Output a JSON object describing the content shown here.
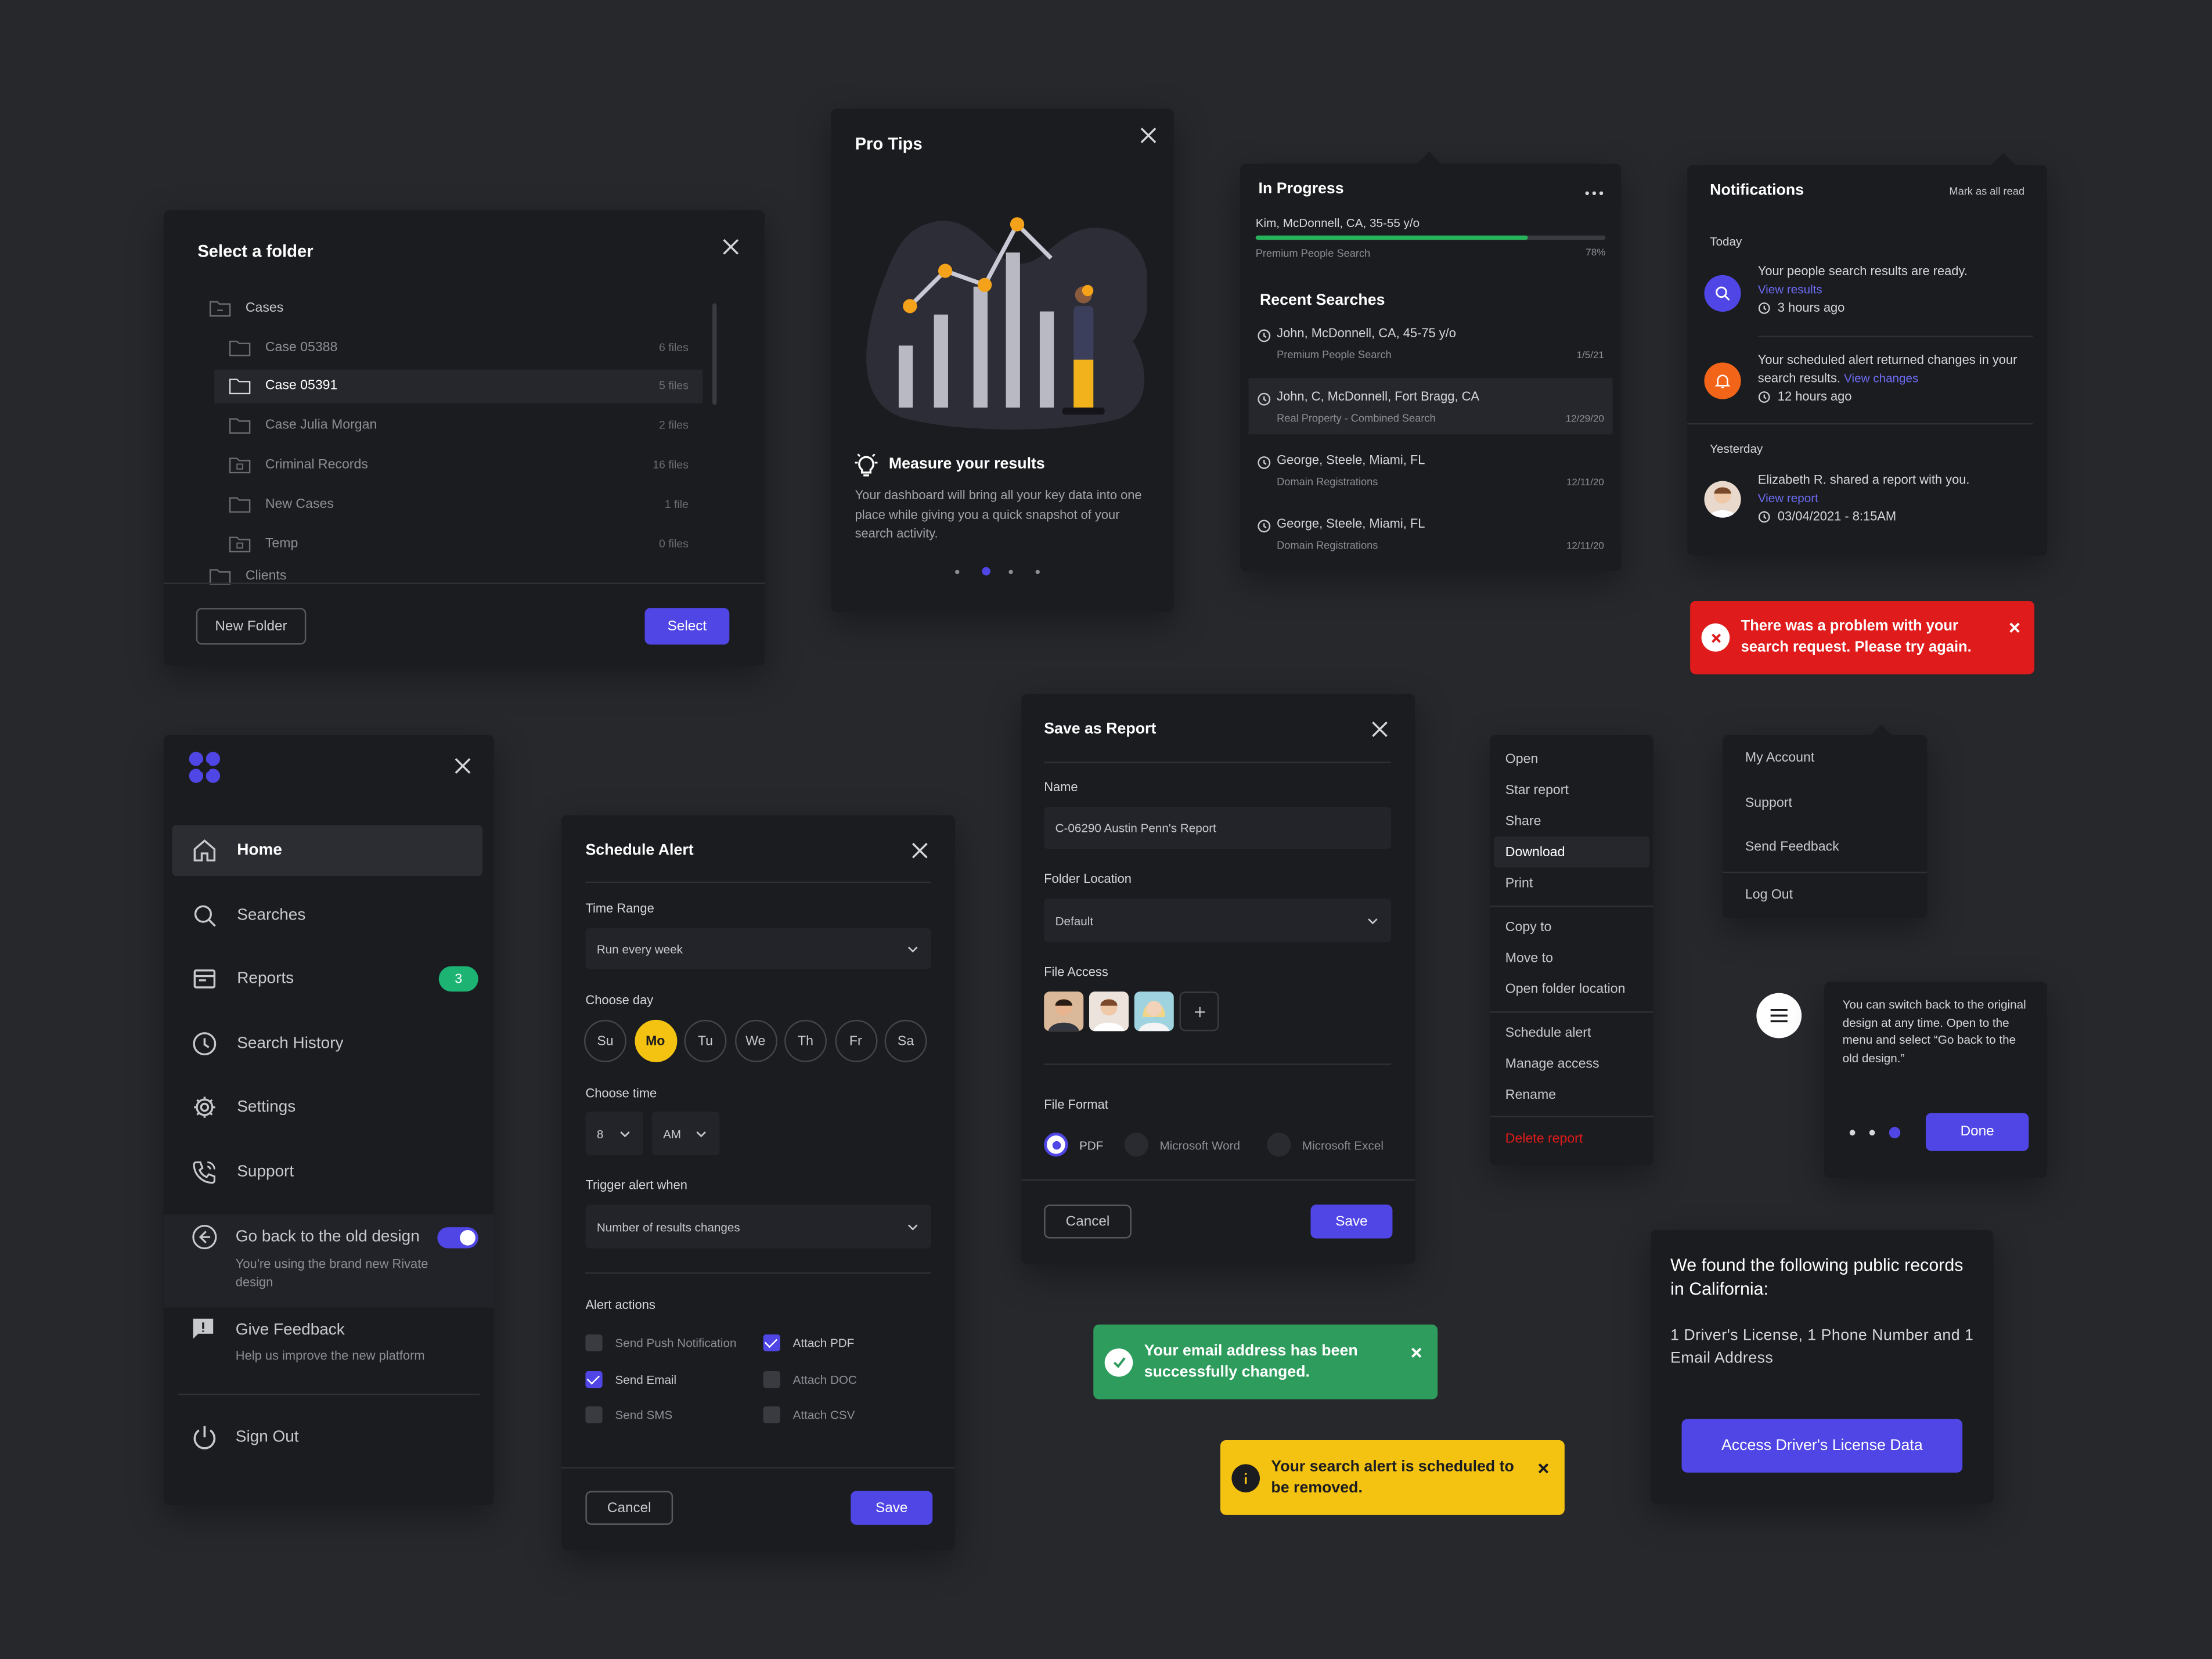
{
  "colors": {
    "background": "#27282c",
    "card": "#1b1c20",
    "accent": "#5046e5",
    "success": "#2e9c5c",
    "warning": "#f4c211",
    "error": "#e01b1b",
    "progress": "#26b35a",
    "badge": "#1db373"
  },
  "folder_dialog": {
    "title": "Select a folder",
    "root_folder": "Cases",
    "items": [
      {
        "name": "Case 05388",
        "count": "6 files"
      },
      {
        "name": "Case 05391",
        "count": "5 files"
      },
      {
        "name": "Case Julia Morgan",
        "count": "2 files"
      },
      {
        "name": "Criminal Records",
        "count": "16 files"
      },
      {
        "name": "New Cases",
        "count": "1 file"
      },
      {
        "name": "Temp",
        "count": "0 files"
      }
    ],
    "next_root": "Clients",
    "new_folder_label": "New Folder",
    "select_label": "Select"
  },
  "pro_tips": {
    "title": "Pro Tips",
    "tip_title": "Measure your results",
    "tip_body": "Your dashboard will bring all your key data into one place while giving you a quick snapshot of your search activity.",
    "pager_active": 2,
    "pager_total": 4,
    "bars": [
      0.4,
      0.6,
      0.78,
      1.0,
      0.62
    ]
  },
  "in_progress": {
    "title": "In Progress",
    "subject": "Kim, McDonnell, CA, 35-55 y/o",
    "type": "Premium People Search",
    "percent_label": "78%",
    "progress": 0.78,
    "recent_title": "Recent Searches",
    "recent": [
      {
        "name": "John, McDonnell, CA, 45-75 y/o",
        "type": "Premium People Search",
        "date": "1/5/21"
      },
      {
        "name": "John, C, McDonnell, Fort Bragg, CA",
        "type": "Real Property - Combined Search",
        "date": "12/29/20"
      },
      {
        "name": "George, Steele, Miami, FL",
        "type": "Domain Registrations",
        "date": "12/11/20"
      },
      {
        "name": "George, Steele, Miami, FL",
        "type": "Domain Registrations",
        "date": "12/11/20"
      }
    ]
  },
  "notifications": {
    "title": "Notifications",
    "mark_all": "Mark as all read",
    "today_label": "Today",
    "yesterday_label": "Yesterday",
    "n1_text": "Your  people search results are ready.",
    "n1_link": "View results",
    "n1_time": "3 hours ago",
    "n2_text": "Your scheduled alert returned changes in your search results.",
    "n2_link": "View changes",
    "n2_time": "12 hours ago",
    "n3_text": "Elizabeth R. shared a report with you.",
    "n3_link": "View report",
    "n3_time": "03/04/2021 - 8:15AM"
  },
  "error_toast": {
    "text": "There was a problem with your search request. Please try again."
  },
  "sidebar": {
    "items": [
      {
        "label": "Home",
        "icon": "home-icon"
      },
      {
        "label": "Searches",
        "icon": "search-icon"
      },
      {
        "label": "Reports",
        "icon": "reports-icon",
        "badge": "3"
      },
      {
        "label": "Search History",
        "icon": "clock-icon"
      },
      {
        "label": "Settings",
        "icon": "gear-icon"
      },
      {
        "label": "Support",
        "icon": "phone-icon"
      }
    ],
    "old_design_title": "Go back to the old design",
    "old_design_desc": "You're using the brand new Rivate design",
    "feedback_title": "Give Feedback",
    "feedback_desc": "Help us improve the new platform",
    "sign_out": "Sign Out"
  },
  "schedule_alert": {
    "title": "Schedule Alert",
    "time_range_label": "Time Range",
    "time_range_value": "Run every week",
    "choose_day_label": "Choose day",
    "days": [
      "Su",
      "Mo",
      "Tu",
      "We",
      "Th",
      "Fr",
      "Sa"
    ],
    "selected_day": "Mo",
    "choose_time_label": "Choose time",
    "hour": "8",
    "ampm": "AM",
    "trigger_label": "Trigger alert when",
    "trigger_value": "Number of results changes",
    "actions_label": "Alert actions",
    "actions": [
      {
        "label": "Send Push Notification",
        "checked": false
      },
      {
        "label": "Attach PDF",
        "checked": true
      },
      {
        "label": "Send Email",
        "checked": true
      },
      {
        "label": "Attach DOC",
        "checked": false
      },
      {
        "label": "Send SMS",
        "checked": false
      },
      {
        "label": "Attach CSV",
        "checked": false
      }
    ],
    "cancel_label": "Cancel",
    "save_label": "Save"
  },
  "save_report": {
    "title": "Save as Report",
    "name_label": "Name",
    "name_value": "C-06290 Austin Penn's Report",
    "folder_label": "Folder Location",
    "folder_value": "Default",
    "access_label": "File Access",
    "format_label": "File Format",
    "formats": [
      "PDF",
      "Microsoft Word",
      "Microsoft Excel"
    ],
    "selected_format": "PDF",
    "cancel_label": "Cancel",
    "save_label": "Save"
  },
  "context_menu": {
    "group1": [
      "Open",
      "Star report",
      "Share",
      "Download",
      "Print"
    ],
    "group2": [
      "Copy to",
      "Move to",
      "Open folder location"
    ],
    "group3": [
      "Schedule alert",
      "Manage access",
      "Rename"
    ],
    "delete": "Delete report"
  },
  "account_menu": {
    "items": [
      "My Account",
      "Support",
      "Send Feedback"
    ],
    "logout": "Log Out"
  },
  "tour_tip": {
    "text": "You can switch back to the original design at any time. Open to the menu and select “Go back to the old design.”",
    "step": 3,
    "total": 3,
    "done_label": "Done"
  },
  "success_toast": {
    "text": "Your email address has been successfully changed."
  },
  "warning_toast": {
    "text": "Your search alert is scheduled to be removed."
  },
  "records_card": {
    "title": "We found the following public records in California:",
    "body": "1 Driver's License, 1 Phone Number and 1 Email Address",
    "button": "Access Driver's License Data"
  }
}
